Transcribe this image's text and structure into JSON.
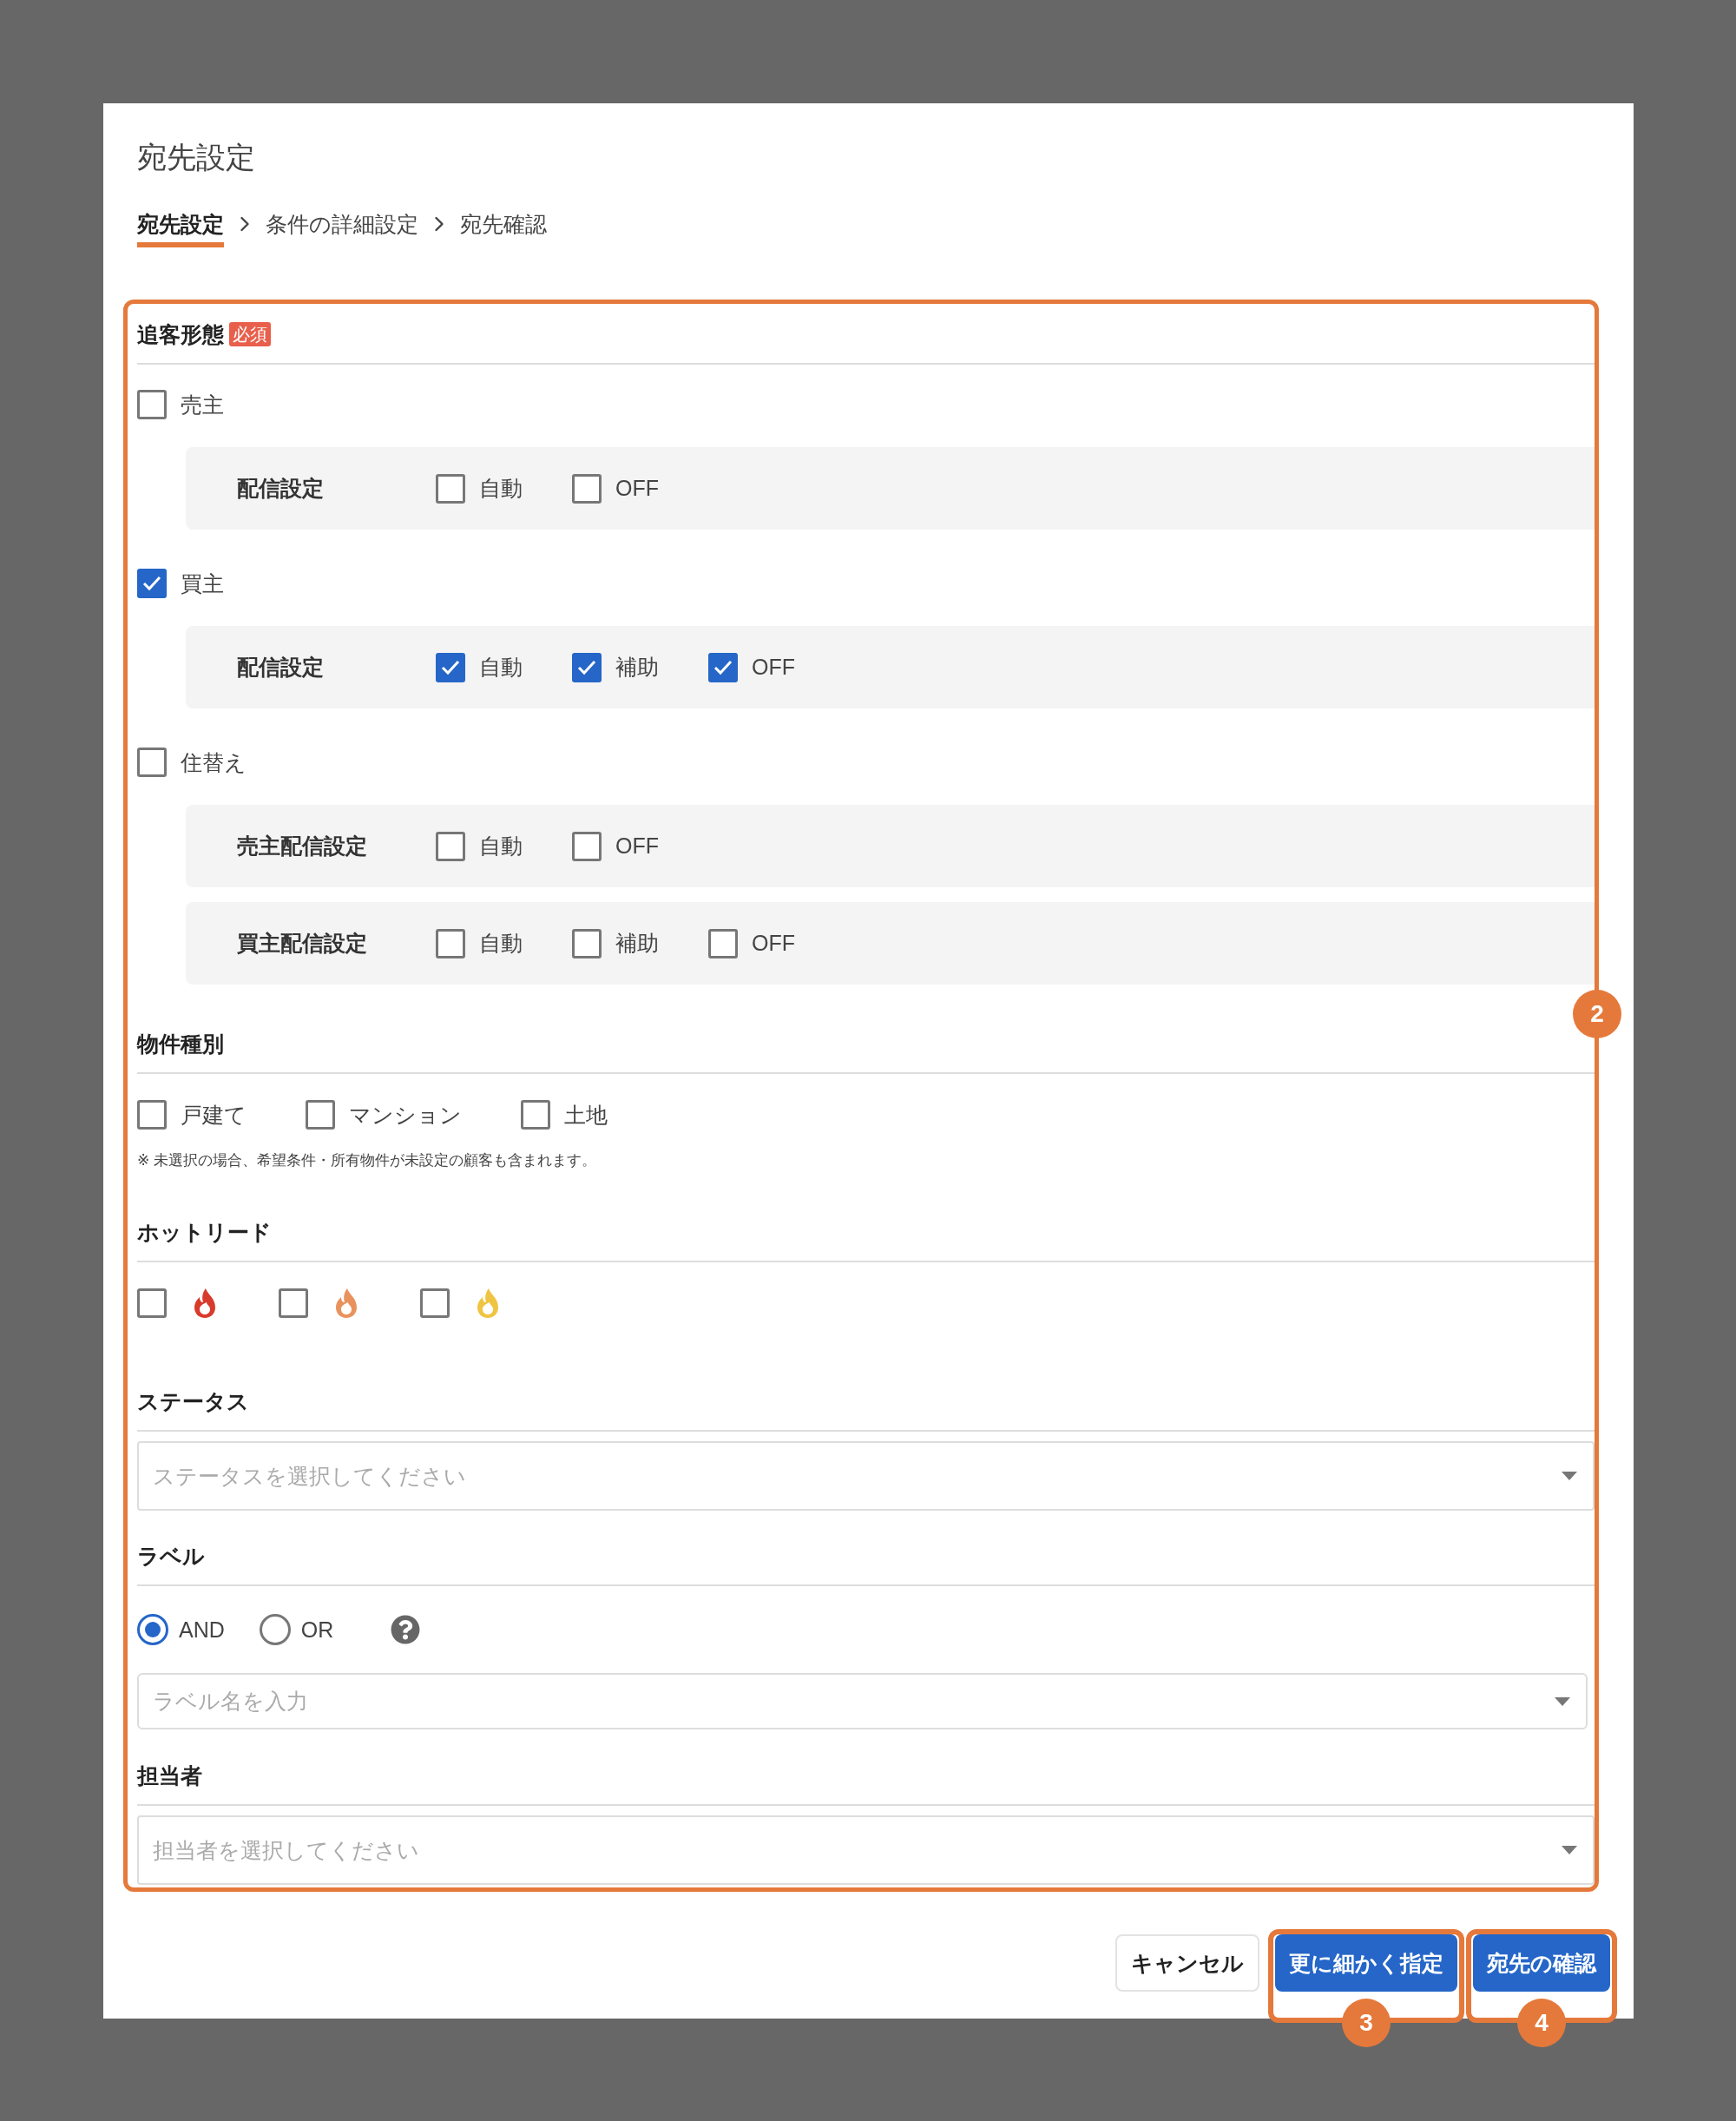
{
  "dialog": {
    "title": "宛先設定"
  },
  "steps": [
    {
      "label": "宛先設定",
      "selected": true
    },
    {
      "label": "条件の詳細設定",
      "selected": false
    },
    {
      "label": "宛先確認",
      "selected": false
    }
  ],
  "callout": "2",
  "sections": [
    {
      "kind": "tracking",
      "heading": "追客形態",
      "required_badge": "必須",
      "groups": [
        {
          "label": "売主",
          "checked": false,
          "settings": [
            {
              "label": "配信設定",
              "options": [
                {
                  "label": "自動",
                  "checked": false
                },
                {
                  "label": "OFF",
                  "checked": false
                }
              ]
            }
          ]
        },
        {
          "label": "買主",
          "checked": true,
          "settings": [
            {
              "label": "配信設定",
              "options": [
                {
                  "label": "自動",
                  "checked": true
                },
                {
                  "label": "補助",
                  "checked": true
                },
                {
                  "label": "OFF",
                  "checked": true
                }
              ]
            }
          ]
        },
        {
          "label": "住替え",
          "checked": false,
          "settings": [
            {
              "label": "売主配信設定",
              "options": [
                {
                  "label": "自動",
                  "checked": false
                },
                {
                  "label": "OFF",
                  "checked": false
                }
              ]
            },
            {
              "label": "買主配信設定",
              "options": [
                {
                  "label": "自動",
                  "checked": false
                },
                {
                  "label": "補助",
                  "checked": false
                },
                {
                  "label": "OFF",
                  "checked": false
                }
              ]
            }
          ]
        }
      ]
    },
    {
      "kind": "checks",
      "heading": "物件種別",
      "options": [
        {
          "label": "戸建て",
          "checked": false
        },
        {
          "label": "マンション",
          "checked": false
        },
        {
          "label": "土地",
          "checked": false
        }
      ],
      "note": "※ 未選択の場合、希望条件・所有物件が未設定の顧客も含まれます。"
    },
    {
      "kind": "flames",
      "heading": "ホットリード",
      "options": [
        {
          "checked": false,
          "color": "#d83b2c"
        },
        {
          "checked": false,
          "color": "#e8935e"
        },
        {
          "checked": false,
          "color": "#f0c443"
        }
      ]
    },
    {
      "kind": "select",
      "heading": "ステータス",
      "placeholder": "ステータスを選択してください"
    },
    {
      "kind": "label",
      "heading": "ラベル",
      "radios": [
        {
          "label": "AND",
          "selected": true
        },
        {
          "label": "OR",
          "selected": false
        }
      ],
      "placeholder": "ラベル名を入力"
    },
    {
      "kind": "select",
      "heading": "担当者",
      "placeholder": "担当者を選択してください"
    }
  ],
  "buttons": [
    {
      "label": "キャンセル",
      "kind": "secondary"
    },
    {
      "label": "更に細かく指定",
      "kind": "primary",
      "callout": "3"
    },
    {
      "label": "宛先の確認",
      "kind": "primary",
      "callout": "4"
    }
  ]
}
